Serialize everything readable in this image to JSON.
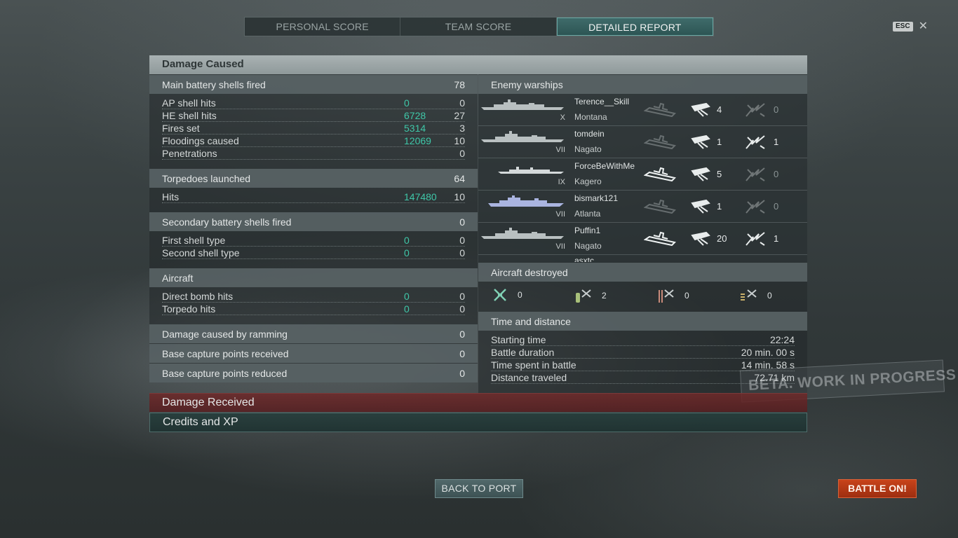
{
  "tabs": [
    {
      "label": "PERSONAL SCORE",
      "active": false
    },
    {
      "label": "TEAM SCORE",
      "active": false
    },
    {
      "label": "DETAILED REPORT",
      "active": true
    }
  ],
  "esc": {
    "key": "ESC",
    "close": "✕"
  },
  "damage_caused": {
    "title": "Damage Caused",
    "main_battery": {
      "label": "Main battery shells fired",
      "value": "78",
      "rows": [
        {
          "label": "AP shell hits",
          "green": "0",
          "value": "0"
        },
        {
          "label": "HE shell hits",
          "green": "6728",
          "value": "27"
        },
        {
          "label": "Fires set",
          "green": "5314",
          "value": "3"
        },
        {
          "label": "Floodings caused",
          "green": "12069",
          "value": "10"
        },
        {
          "label": "Penetrations",
          "green": "",
          "value": "0"
        }
      ]
    },
    "torpedoes": {
      "label": "Torpedoes launched",
      "value": "64",
      "rows": [
        {
          "label": "Hits",
          "green": "147480",
          "value": "10"
        }
      ]
    },
    "secondary": {
      "label": "Secondary battery shells fired",
      "value": "0",
      "rows": [
        {
          "label": "First shell type",
          "green": "0",
          "value": "0"
        },
        {
          "label": "Second shell type",
          "green": "0",
          "value": "0"
        }
      ]
    },
    "aircraft": {
      "label": "Aircraft",
      "value": "",
      "rows": [
        {
          "label": "Direct bomb hits",
          "green": "0",
          "value": "0"
        },
        {
          "label": "Torpedo hits",
          "green": "0",
          "value": "0"
        }
      ]
    },
    "ramming": {
      "label": "Damage caused by ramming",
      "value": "0"
    },
    "base_received": {
      "label": "Base capture points received",
      "value": "0"
    },
    "base_reduced": {
      "label": "Base capture points reduced",
      "value": "0"
    }
  },
  "enemy_warships": {
    "title": "Enemy warships",
    "ships": [
      {
        "tier": "X",
        "player": "Terence__Skill",
        "ship": "Montana",
        "sunk": false,
        "hits": "4",
        "fires": "0",
        "fire_active": false
      },
      {
        "tier": "VII",
        "player": "tomdein",
        "ship": "Nagato",
        "sunk": false,
        "hits": "1",
        "fires": "1",
        "fire_active": true
      },
      {
        "tier": "IX",
        "player": "ForceBeWithMe",
        "ship": "Kagero",
        "sunk": true,
        "hits": "5",
        "fires": "0",
        "fire_active": false
      },
      {
        "tier": "VII",
        "player": "bismark121",
        "ship": "Atlanta",
        "sunk": false,
        "hits": "1",
        "fires": "0",
        "fire_active": false,
        "highlight": true
      },
      {
        "tier": "VII",
        "player": "Puffin1",
        "ship": "Nagato",
        "sunk": true,
        "hits": "20",
        "fires": "1",
        "fire_active": true
      }
    ],
    "partial_next_player": "asxtc"
  },
  "aircraft_destroyed": {
    "title": "Aircraft destroyed",
    "items": [
      {
        "icon": "fighter-plane-icon",
        "value": "0"
      },
      {
        "icon": "dive-bomber-icon",
        "value": "2"
      },
      {
        "icon": "torpedo-bomber-icon",
        "value": "0"
      },
      {
        "icon": "spotter-plane-icon",
        "value": "0"
      }
    ]
  },
  "time_distance": {
    "title": "Time and distance",
    "rows": [
      {
        "label": "Starting time",
        "value": "22:24"
      },
      {
        "label": "Battle duration",
        "value": "20 min. 00 s"
      },
      {
        "label": "Time spent in battle",
        "value": "14 min. 58 s"
      },
      {
        "label": "Distance traveled",
        "value": "72.71 km"
      }
    ]
  },
  "watermark": "BETA. WORK IN PROGRESS",
  "sections": {
    "damage_received": "Damage Received",
    "credits_xp": "Credits and XP"
  },
  "buttons": {
    "back_to_port": "BACK TO PORT",
    "battle_on": "BATTLE ON!"
  },
  "colors": {
    "accent_green": "#3fc7a8",
    "battle_button": "#c8431a",
    "damage_received_bar": "#6e2828"
  }
}
